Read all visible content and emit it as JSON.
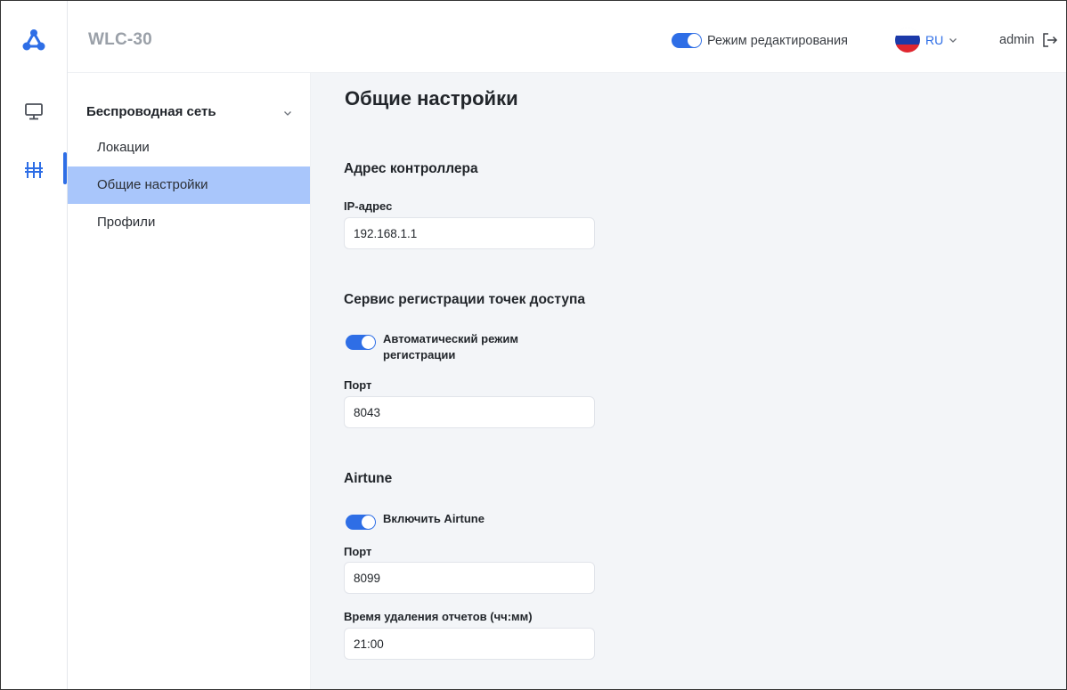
{
  "header": {
    "app_title": "WLC-30",
    "edit_mode_label": "Режим редактирования",
    "language": "RU",
    "user": "admin"
  },
  "sidebar": {
    "group_label": "Беспроводная сеть",
    "items": [
      {
        "label": "Локации"
      },
      {
        "label": "Общие настройки"
      },
      {
        "label": "Профили"
      }
    ]
  },
  "main": {
    "title": "Общие настройки",
    "controller": {
      "section_title": "Адрес контроллера",
      "ip_label": "IP-адрес",
      "ip_value": "192.168.1.1"
    },
    "registration": {
      "section_title": "Сервис регистрации точек доступа",
      "auto_mode_line1": "Автоматический режим",
      "auto_mode_line2": "регистрации",
      "port_label": "Порт",
      "port_value": "8043"
    },
    "airtune": {
      "section_title": "Airtune",
      "enable_label": "Включить Airtune",
      "port_label": "Порт",
      "port_value": "8099",
      "report_time_label": "Время удаления отчетов (чч:мм)",
      "report_time_value": "21:00"
    }
  },
  "colors": {
    "accent": "#2e6ee6",
    "active_nav": "#a9c6fb",
    "content_bg": "#f3f5f8"
  },
  "icons": {
    "logo": "network-logo-icon",
    "monitor": "monitor-icon",
    "wireless": "equalizer-icon",
    "chevron": "chevron-down-icon",
    "logout": "logout-icon",
    "flag": "flag-ru-icon"
  }
}
